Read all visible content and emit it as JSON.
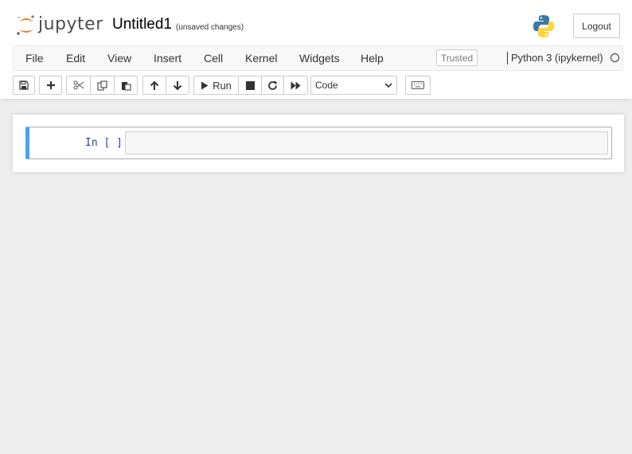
{
  "header": {
    "logo_text": "jupyter",
    "notebook_title": "Untitled1",
    "save_status": "(unsaved changes)",
    "logout_label": "Logout"
  },
  "menubar": {
    "items": [
      "File",
      "Edit",
      "View",
      "Insert",
      "Cell",
      "Kernel",
      "Widgets",
      "Help"
    ],
    "trusted_label": "Trusted",
    "kernel_name": "Python 3 (ipykernel)"
  },
  "toolbar": {
    "run_label": "Run",
    "cell_type": "Code",
    "icons": [
      "save-icon",
      "plus-icon",
      "cut-icon",
      "copy-icon",
      "paste-icon",
      "arrow-up-icon",
      "arrow-down-icon",
      "play-icon",
      "stop-icon",
      "restart-icon",
      "fast-forward-icon",
      "keyboard-icon"
    ]
  },
  "cell": {
    "prompt": "In [ ]:",
    "code": ""
  },
  "colors": {
    "accent": "#f37726",
    "selected_cell_border": "#42a5f5",
    "prompt_color": "#303f9f"
  }
}
